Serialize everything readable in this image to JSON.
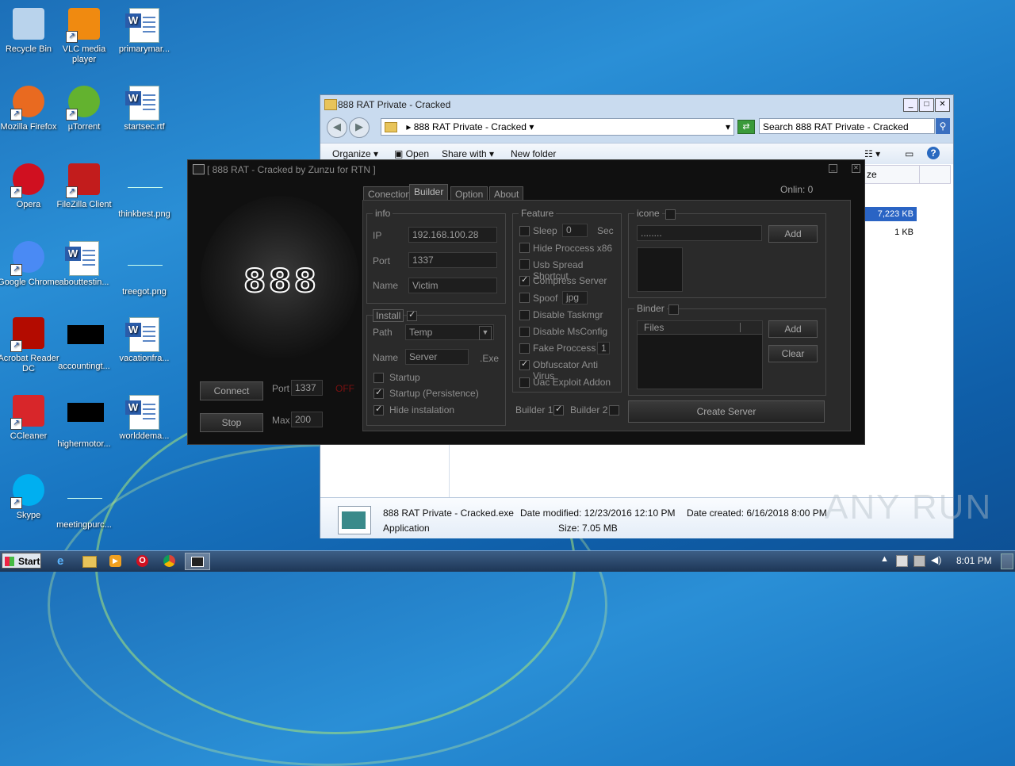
{
  "desktop": {
    "icons": [
      {
        "label": "Recycle Bin",
        "icon": "recycle-bin-icon"
      },
      {
        "label": "VLC media player",
        "icon": "vlc-icon"
      },
      {
        "label": "primarymar...",
        "icon": "word-doc-icon"
      },
      {
        "label": "Mozilla Firefox",
        "icon": "firefox-icon"
      },
      {
        "label": "µTorrent",
        "icon": "utorrent-icon"
      },
      {
        "label": "startsec.rtf",
        "icon": "word-doc-icon"
      },
      {
        "label": "Opera",
        "icon": "opera-icon"
      },
      {
        "label": "FileZilla Client",
        "icon": "filezilla-icon"
      },
      {
        "label": "thinkbest.png",
        "icon": "image-file-icon"
      },
      {
        "label": "Google Chrome",
        "icon": "chrome-icon"
      },
      {
        "label": "abouttestin...",
        "icon": "word-doc-icon"
      },
      {
        "label": "treegot.png",
        "icon": "image-file-icon"
      },
      {
        "label": "Acrobat Reader DC",
        "icon": "acrobat-icon"
      },
      {
        "label": "accountingt...",
        "icon": "black-image-icon"
      },
      {
        "label": "vacationfra...",
        "icon": "word-doc-icon"
      },
      {
        "label": "CCleaner",
        "icon": "ccleaner-icon"
      },
      {
        "label": "highermotor...",
        "icon": "black-image-icon"
      },
      {
        "label": "worlddema...",
        "icon": "word-doc-icon"
      },
      {
        "label": "Skype",
        "icon": "skype-icon"
      },
      {
        "label": "meetingpurc...",
        "icon": "image-file-icon"
      }
    ]
  },
  "explorer": {
    "title": "888 RAT Private - Cracked",
    "address": "888 RAT Private - Cracked",
    "search_placeholder": "Search 888 RAT Private - Cracked",
    "toolbar": {
      "organize": "Organize",
      "open": "Open",
      "share_with": "Share with",
      "new_folder": "New folder"
    },
    "column_header": "ze",
    "sizes": [
      "7,223 KB",
      "1 KB"
    ],
    "details": {
      "filename": "888 RAT Private - Cracked.exe",
      "type": "Application",
      "date_modified": "Date modified: 12/23/2016 12:10 PM",
      "size": "Size: 7.05 MB",
      "date_created": "Date created: 6/16/2018 8:00 PM"
    }
  },
  "rat": {
    "title": "[ 888 RAT - Cracked by Zunzu for RTN ]",
    "logo": "888",
    "online": "Onlin:  0",
    "tabs": [
      "Conection",
      "Builder",
      "Option",
      "About"
    ],
    "connect_label": "Connect",
    "stop_label": "Stop",
    "port_label": "Port",
    "port_value": "1337",
    "off_label": "OFF",
    "max_label": "Max",
    "max_value": "200",
    "info": {
      "title": "info",
      "ip_label": "IP",
      "ip_value": "192.168.100.28",
      "port_label": "Port",
      "port_value": "1337",
      "name_label": "Name",
      "name_value": "Victim"
    },
    "install": {
      "title": "Install",
      "path_label": "Path",
      "path_value": "Temp",
      "name_label": "Name",
      "name_value": "Server",
      "ext": ".Exe",
      "options": [
        {
          "label": "Startup",
          "checked": false
        },
        {
          "label": "Startup (Persistence)",
          "checked": true
        },
        {
          "label": "Hide instalation",
          "checked": true
        }
      ]
    },
    "feature": {
      "title": "Feature",
      "sleep_label": "Sleep",
      "sleep_value": "0",
      "sleep_unit": "Sec",
      "items": [
        {
          "label": "Hide Proccess x86",
          "checked": false
        },
        {
          "label": "Usb Spread Shortcut",
          "checked": false
        },
        {
          "label": "Compress Server",
          "checked": true
        }
      ],
      "spoof_label": "Spoof",
      "spoof_value": "jpg",
      "items2": [
        {
          "label": "Disable Taskmgr",
          "checked": false
        },
        {
          "label": "Disable MsConfig",
          "checked": false
        }
      ],
      "fake_label": "Fake Proccess",
      "fake_value": "1",
      "items3": [
        {
          "label": "Obfuscator Anti Virus",
          "checked": true
        },
        {
          "label": "Uac Exploit Addon",
          "checked": false
        }
      ]
    },
    "builder1": "Builder 1",
    "builder2": "Builder 2",
    "icone": {
      "title": "icone",
      "path": "........",
      "add": "Add"
    },
    "binder": {
      "title": "Binder",
      "files_header": "Files",
      "add": "Add",
      "clear": "Clear"
    },
    "create_server": "Create Server"
  },
  "taskbar": {
    "start": "Start",
    "time": "8:01 PM"
  },
  "watermark": "ANY RUN"
}
